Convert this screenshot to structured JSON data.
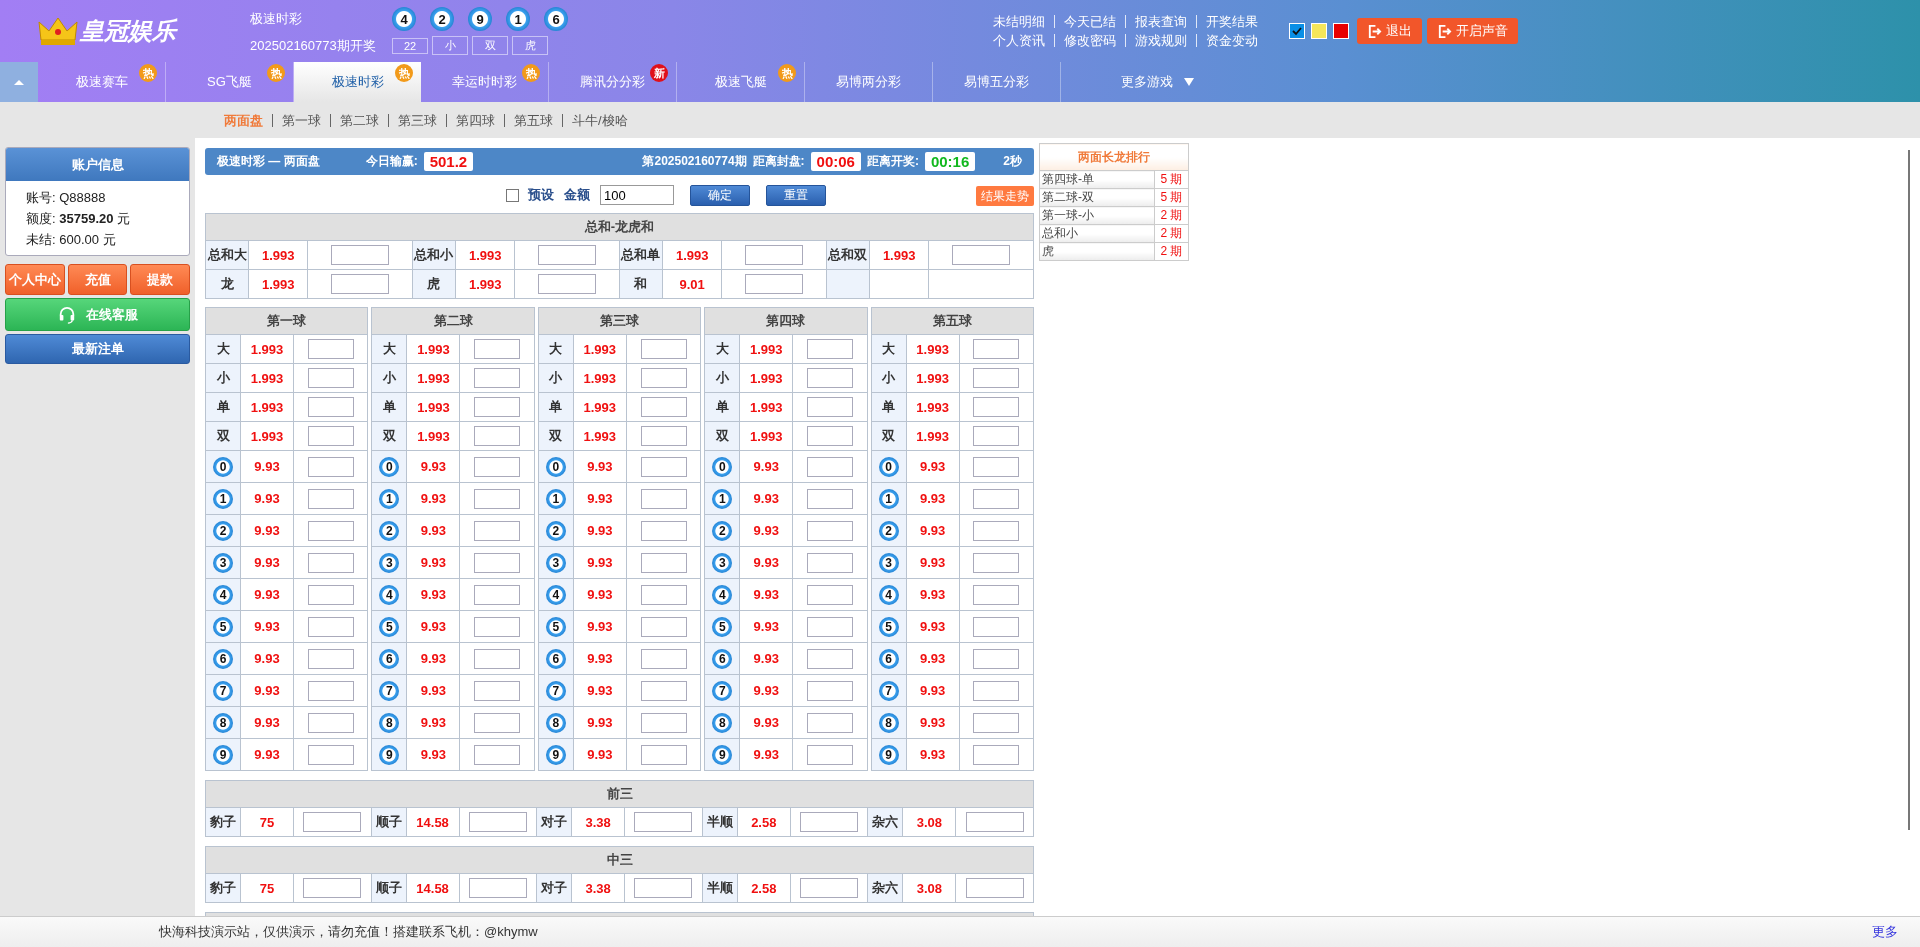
{
  "header": {
    "logo": "皇冠娱乐",
    "game": "极速时彩",
    "draw_balls": [
      "4",
      "2",
      "9",
      "1",
      "6"
    ],
    "period": "202502160773期开奖",
    "draw_tags": [
      "22",
      "小",
      "双",
      "虎"
    ],
    "link_rows": [
      {
        "links": [
          "未结明细",
          "今天已结",
          "报表查询",
          "开奖结果"
        ]
      },
      {
        "links": [
          "个人资讯",
          "修改密码",
          "游戏规则",
          "资金变动"
        ]
      }
    ],
    "themes": [
      {
        "color": "#0a8fe6",
        "selected": true
      },
      {
        "color": "#f5e65a",
        "selected": false
      },
      {
        "color": "#e80000",
        "selected": false
      }
    ],
    "buttons": [
      {
        "label": "退出"
      },
      {
        "label": "开启声音"
      }
    ]
  },
  "nav": {
    "tabs": [
      {
        "label": "极速赛车",
        "selected": false,
        "badge": {
          "text": "热",
          "kind": "hot"
        }
      },
      {
        "label": "SG飞艇",
        "selected": false,
        "badge": {
          "text": "热",
          "kind": "hot"
        }
      },
      {
        "label": "极速时彩",
        "selected": true,
        "badge": {
          "text": "热",
          "kind": "hot"
        }
      },
      {
        "label": "幸运时时彩",
        "selected": false,
        "badge": {
          "text": "热",
          "kind": "hot"
        }
      },
      {
        "label": "腾讯分分彩",
        "selected": false,
        "badge": {
          "text": "新",
          "kind": "new"
        }
      },
      {
        "label": "极速飞艇",
        "selected": false,
        "badge": {
          "text": "热",
          "kind": "hot"
        }
      },
      {
        "label": "易博两分彩",
        "selected": false
      },
      {
        "label": "易博五分彩",
        "selected": false
      }
    ],
    "more": "更多游戏"
  },
  "subnav": [
    {
      "label": "两面盘",
      "selected": true
    },
    {
      "label": "第一球",
      "selected": false
    },
    {
      "label": "第二球",
      "selected": false
    },
    {
      "label": "第三球",
      "selected": false
    },
    {
      "label": "第四球",
      "selected": false
    },
    {
      "label": "第五球",
      "selected": false
    },
    {
      "label": "斗牛/梭哈",
      "selected": false
    }
  ],
  "account": {
    "title": "账户信息",
    "rows": [
      {
        "label": "账号:",
        "value": "Q88888",
        "emphasis": false
      },
      {
        "label": "额度:",
        "value": "35759.20",
        "unit": "元",
        "emphasis": true
      },
      {
        "label": "未结:",
        "value": "600.00",
        "unit": "元",
        "emphasis": false
      }
    ],
    "buttons": [
      "个人中心",
      "充值",
      "提款"
    ],
    "service_button": "在线客服",
    "recent_button": "最新注单"
  },
  "info_bar": {
    "title": "极速时彩 — 两面盘",
    "today_label": "今日输赢:",
    "today_value": "501.2",
    "period": "第202502160774期",
    "close_label": "距离封盘:",
    "close_time": "00:06",
    "open_label": "距离开奖:",
    "open_time": "00:16",
    "refresh": "2秒"
  },
  "controls": {
    "preset_label": "预设",
    "preset_checked": false,
    "amount_label": "金额",
    "amount": "100",
    "buttons": [
      "确定",
      "重置"
    ],
    "trend_button": "结果走势"
  },
  "sum_table": {
    "title": "总和-龙虎和",
    "cells": [
      {
        "label": "总和大",
        "odds": "1.993"
      },
      {
        "label": "总和小",
        "odds": "1.993"
      },
      {
        "label": "总和单",
        "odds": "1.993"
      },
      {
        "label": "总和双",
        "odds": "1.993"
      },
      {
        "label": "龙",
        "odds": "1.993"
      },
      {
        "label": "虎",
        "odds": "1.993"
      },
      {
        "label": "和",
        "odds": "9.01"
      }
    ]
  },
  "balls": [
    {
      "title": "第一球",
      "rows": [
        {
          "kind": "text",
          "label": "大",
          "odds": "1.993"
        },
        {
          "kind": "text",
          "label": "小",
          "odds": "1.993"
        },
        {
          "kind": "text",
          "label": "单",
          "odds": "1.993"
        },
        {
          "kind": "text",
          "label": "双",
          "odds": "1.993"
        },
        {
          "kind": "ball",
          "label": "0",
          "odds": "9.93"
        },
        {
          "kind": "ball",
          "label": "1",
          "odds": "9.93"
        },
        {
          "kind": "ball",
          "label": "2",
          "odds": "9.93"
        },
        {
          "kind": "ball",
          "label": "3",
          "odds": "9.93"
        },
        {
          "kind": "ball",
          "label": "4",
          "odds": "9.93"
        },
        {
          "kind": "ball",
          "label": "5",
          "odds": "9.93"
        },
        {
          "kind": "ball",
          "label": "6",
          "odds": "9.93"
        },
        {
          "kind": "ball",
          "label": "7",
          "odds": "9.93"
        },
        {
          "kind": "ball",
          "label": "8",
          "odds": "9.93"
        },
        {
          "kind": "ball",
          "label": "9",
          "odds": "9.93"
        }
      ]
    },
    {
      "title": "第二球",
      "rows": [
        {
          "kind": "text",
          "label": "大",
          "odds": "1.993"
        },
        {
          "kind": "text",
          "label": "小",
          "odds": "1.993"
        },
        {
          "kind": "text",
          "label": "单",
          "odds": "1.993"
        },
        {
          "kind": "text",
          "label": "双",
          "odds": "1.993"
        },
        {
          "kind": "ball",
          "label": "0",
          "odds": "9.93"
        },
        {
          "kind": "ball",
          "label": "1",
          "odds": "9.93"
        },
        {
          "kind": "ball",
          "label": "2",
          "odds": "9.93"
        },
        {
          "kind": "ball",
          "label": "3",
          "odds": "9.93"
        },
        {
          "kind": "ball",
          "label": "4",
          "odds": "9.93"
        },
        {
          "kind": "ball",
          "label": "5",
          "odds": "9.93"
        },
        {
          "kind": "ball",
          "label": "6",
          "odds": "9.93"
        },
        {
          "kind": "ball",
          "label": "7",
          "odds": "9.93"
        },
        {
          "kind": "ball",
          "label": "8",
          "odds": "9.93"
        },
        {
          "kind": "ball",
          "label": "9",
          "odds": "9.93"
        }
      ]
    },
    {
      "title": "第三球",
      "rows": [
        {
          "kind": "text",
          "label": "大",
          "odds": "1.993"
        },
        {
          "kind": "text",
          "label": "小",
          "odds": "1.993"
        },
        {
          "kind": "text",
          "label": "单",
          "odds": "1.993"
        },
        {
          "kind": "text",
          "label": "双",
          "odds": "1.993"
        },
        {
          "kind": "ball",
          "label": "0",
          "odds": "9.93"
        },
        {
          "kind": "ball",
          "label": "1",
          "odds": "9.93"
        },
        {
          "kind": "ball",
          "label": "2",
          "odds": "9.93"
        },
        {
          "kind": "ball",
          "label": "3",
          "odds": "9.93"
        },
        {
          "kind": "ball",
          "label": "4",
          "odds": "9.93"
        },
        {
          "kind": "ball",
          "label": "5",
          "odds": "9.93"
        },
        {
          "kind": "ball",
          "label": "6",
          "odds": "9.93"
        },
        {
          "kind": "ball",
          "label": "7",
          "odds": "9.93"
        },
        {
          "kind": "ball",
          "label": "8",
          "odds": "9.93"
        },
        {
          "kind": "ball",
          "label": "9",
          "odds": "9.93"
        }
      ]
    },
    {
      "title": "第四球",
      "rows": [
        {
          "kind": "text",
          "label": "大",
          "odds": "1.993"
        },
        {
          "kind": "text",
          "label": "小",
          "odds": "1.993"
        },
        {
          "kind": "text",
          "label": "单",
          "odds": "1.993"
        },
        {
          "kind": "text",
          "label": "双",
          "odds": "1.993"
        },
        {
          "kind": "ball",
          "label": "0",
          "odds": "9.93"
        },
        {
          "kind": "ball",
          "label": "1",
          "odds": "9.93"
        },
        {
          "kind": "ball",
          "label": "2",
          "odds": "9.93"
        },
        {
          "kind": "ball",
          "label": "3",
          "odds": "9.93"
        },
        {
          "kind": "ball",
          "label": "4",
          "odds": "9.93"
        },
        {
          "kind": "ball",
          "label": "5",
          "odds": "9.93"
        },
        {
          "kind": "ball",
          "label": "6",
          "odds": "9.93"
        },
        {
          "kind": "ball",
          "label": "7",
          "odds": "9.93"
        },
        {
          "kind": "ball",
          "label": "8",
          "odds": "9.93"
        },
        {
          "kind": "ball",
          "label": "9",
          "odds": "9.93"
        }
      ]
    },
    {
      "title": "第五球",
      "rows": [
        {
          "kind": "text",
          "label": "大",
          "odds": "1.993"
        },
        {
          "kind": "text",
          "label": "小",
          "odds": "1.993"
        },
        {
          "kind": "text",
          "label": "单",
          "odds": "1.993"
        },
        {
          "kind": "text",
          "label": "双",
          "odds": "1.993"
        },
        {
          "kind": "ball",
          "label": "0",
          "odds": "9.93"
        },
        {
          "kind": "ball",
          "label": "1",
          "odds": "9.93"
        },
        {
          "kind": "ball",
          "label": "2",
          "odds": "9.93"
        },
        {
          "kind": "ball",
          "label": "3",
          "odds": "9.93"
        },
        {
          "kind": "ball",
          "label": "4",
          "odds": "9.93"
        },
        {
          "kind": "ball",
          "label": "5",
          "odds": "9.93"
        },
        {
          "kind": "ball",
          "label": "6",
          "odds": "9.93"
        },
        {
          "kind": "ball",
          "label": "7",
          "odds": "9.93"
        },
        {
          "kind": "ball",
          "label": "8",
          "odds": "9.93"
        },
        {
          "kind": "ball",
          "label": "9",
          "odds": "9.93"
        }
      ]
    }
  ],
  "combo_tables": [
    {
      "title": "前三",
      "cells": [
        {
          "label": "豹子",
          "odds": "75"
        },
        {
          "label": "顺子",
          "odds": "14.58"
        },
        {
          "label": "对子",
          "odds": "3.38"
        },
        {
          "label": "半顺",
          "odds": "2.58"
        },
        {
          "label": "杂六",
          "odds": "3.08"
        }
      ]
    },
    {
      "title": "中三",
      "cells": [
        {
          "label": "豹子",
          "odds": "75"
        },
        {
          "label": "顺子",
          "odds": "14.58"
        },
        {
          "label": "对子",
          "odds": "3.38"
        },
        {
          "label": "半顺",
          "odds": "2.58"
        },
        {
          "label": "杂六",
          "odds": "3.08"
        }
      ]
    }
  ],
  "ranking": {
    "title": "两面长龙排行",
    "rows": [
      {
        "label": "第四球-单",
        "count": "5 期"
      },
      {
        "label": "第二球-双",
        "count": "5 期"
      },
      {
        "label": "第一球-小",
        "count": "2 期"
      },
      {
        "label": "总和小",
        "count": "2 期"
      },
      {
        "label": "虎",
        "count": "2 期"
      }
    ]
  },
  "footer": {
    "notice": "快海科技演示站，仅供演示，请勿充值！搭建联系飞机：@khymw",
    "more": "更多"
  }
}
